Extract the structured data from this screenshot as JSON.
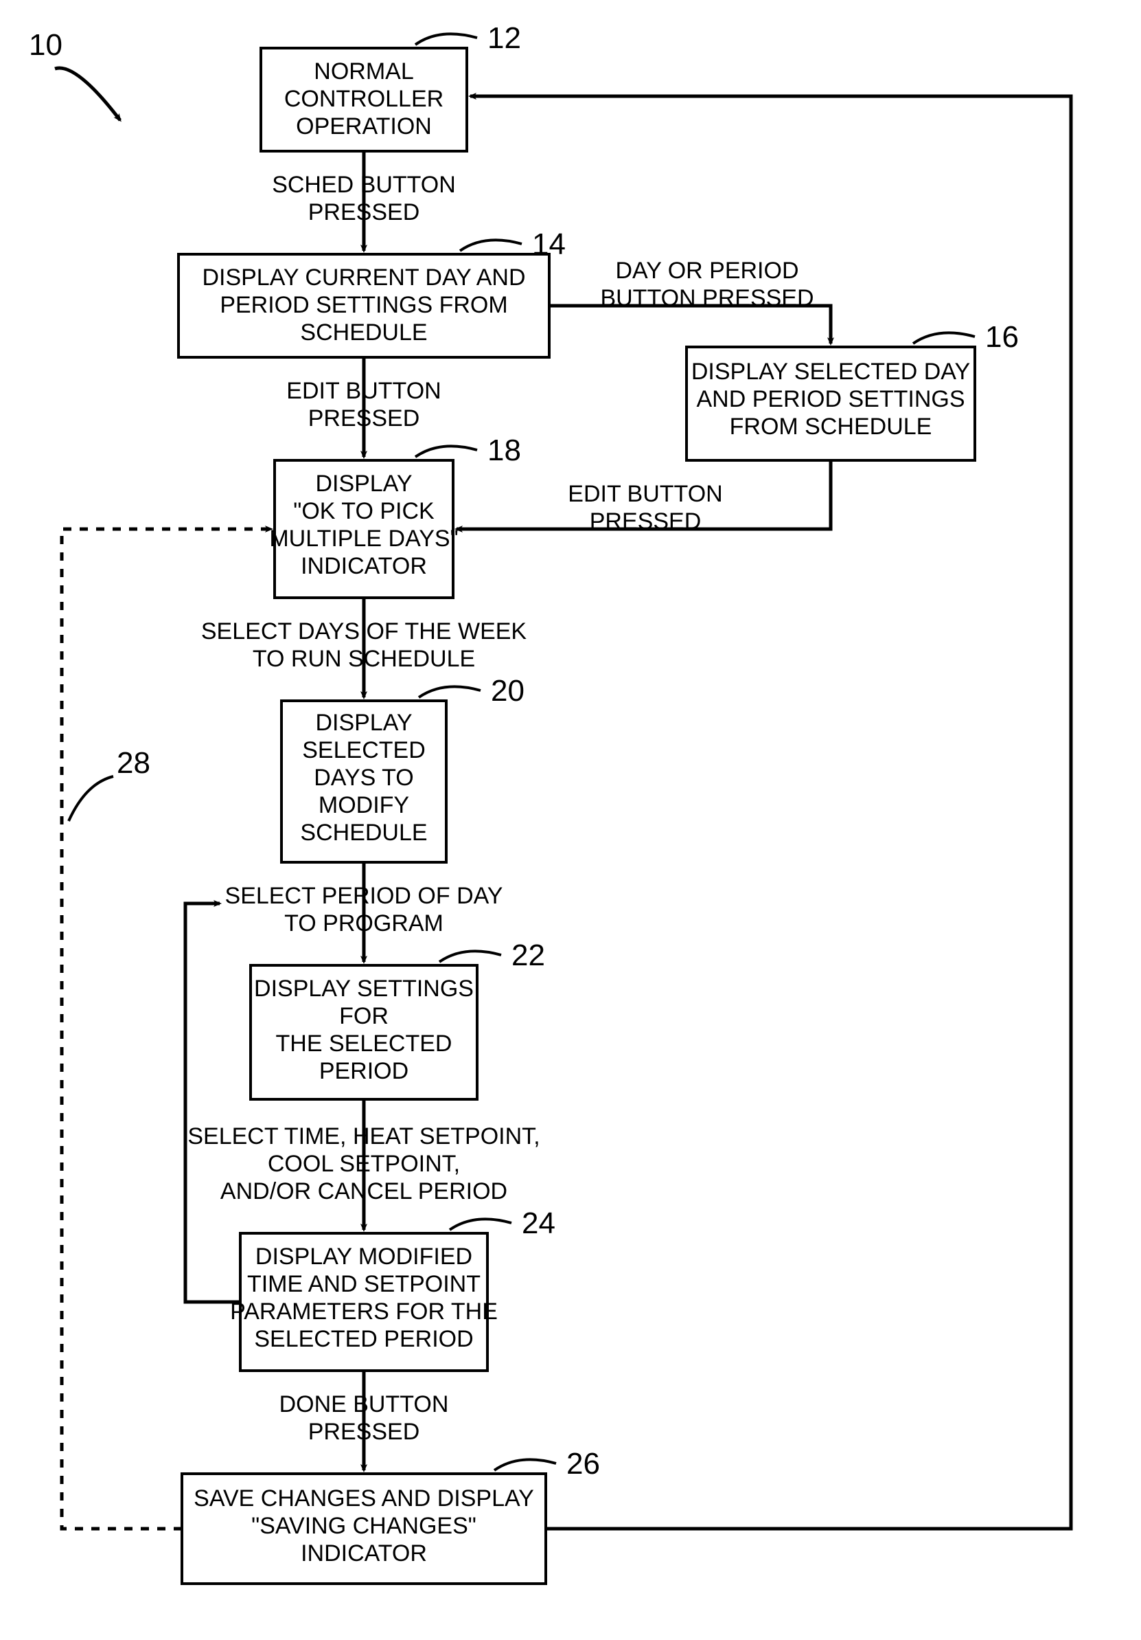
{
  "refs": {
    "r10": "10",
    "r12": "12",
    "r14": "14",
    "r16": "16",
    "r18": "18",
    "r20": "20",
    "r22": "22",
    "r24": "24",
    "r26": "26",
    "r28": "28"
  },
  "b12": {
    "l1": "NORMAL",
    "l2": "CONTROLLER",
    "l3": "OPERATION"
  },
  "b14": {
    "l1": "DISPLAY CURRENT DAY AND",
    "l2": "PERIOD SETTINGS FROM",
    "l3": "SCHEDULE"
  },
  "b16": {
    "l1": "DISPLAY SELECTED DAY",
    "l2": "AND PERIOD SETTINGS",
    "l3": "FROM SCHEDULE"
  },
  "b18": {
    "l1": "DISPLAY",
    "l2": "\"OK TO PICK",
    "l3": "MULTIPLE DAYS\"",
    "l4": "INDICATOR"
  },
  "b20": {
    "l1": "DISPLAY",
    "l2": "SELECTED",
    "l3": "DAYS TO",
    "l4": "MODIFY",
    "l5": "SCHEDULE"
  },
  "b22": {
    "l1": "DISPLAY SETTINGS",
    "l2": "FOR",
    "l3": "THE SELECTED",
    "l4": "PERIOD"
  },
  "b24": {
    "l1": "DISPLAY MODIFIED",
    "l2": "TIME AND SETPOINT",
    "l3": "PARAMETERS FOR THE",
    "l4": "SELECTED PERIOD"
  },
  "b26": {
    "l1": "SAVE CHANGES AND DISPLAY",
    "l2": "\"SAVING CHANGES\"",
    "l3": "INDICATOR"
  },
  "e": {
    "sched": {
      "l1": "SCHED BUTTON",
      "l2": "PRESSED"
    },
    "editA": {
      "l1": "EDIT BUTTON",
      "l2": "PRESSED"
    },
    "dayper": {
      "l1": "DAY OR PERIOD",
      "l2": "BUTTON PRESSED"
    },
    "editB": {
      "l1": "EDIT BUTTON",
      "l2": "PRESSED"
    },
    "seldays": {
      "l1": "SELECT DAYS OF THE WEEK",
      "l2": "TO RUN SCHEDULE"
    },
    "selperiod": {
      "l1": "SELECT PERIOD OF DAY",
      "l2": "TO PROGRAM"
    },
    "seltime": {
      "l1": "SELECT TIME, HEAT SETPOINT,",
      "l2": "COOL SETPOINT,",
      "l3": "AND/OR CANCEL PERIOD"
    },
    "done": {
      "l1": "DONE BUTTON",
      "l2": "PRESSED"
    }
  }
}
